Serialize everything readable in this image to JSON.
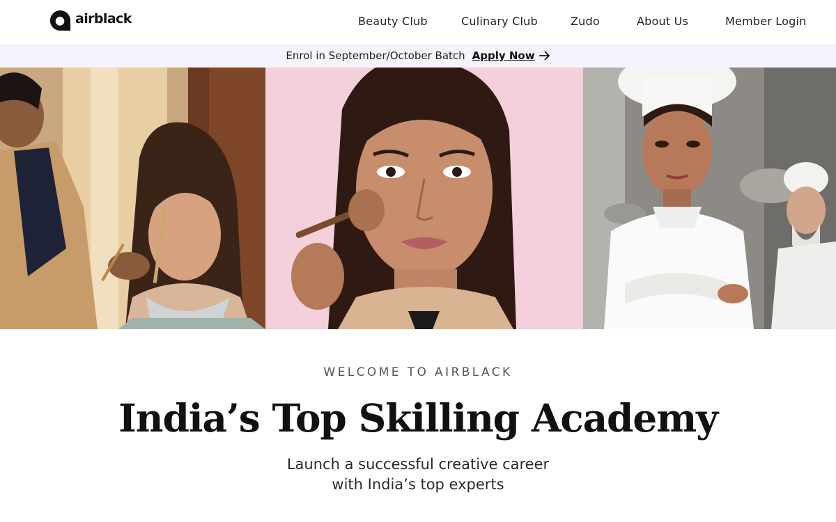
{
  "brand": {
    "name": "airblack",
    "logo_icon": "airblack-logo-icon"
  },
  "nav": {
    "links": [
      {
        "label": "Beauty Club"
      },
      {
        "label": "Culinary Club"
      },
      {
        "label": "Zudo"
      },
      {
        "label": "About Us"
      },
      {
        "label": "Member Login"
      }
    ]
  },
  "announcement": {
    "text": "Enrol in September/October Batch",
    "cta_label": "Apply Now",
    "cta_icon": "arrow-right-icon"
  },
  "hero": {
    "images": [
      {
        "alt": "Makeup artist applying makeup to a bride"
      },
      {
        "alt": "Woman applying blush with a brush"
      },
      {
        "alt": "Chef in white chef uniform"
      }
    ]
  },
  "intro": {
    "eyebrow": "WELCOME TO AIRBLACK",
    "headline": "India’s Top Skilling Academy",
    "subline_1": "Launch a successful creative career",
    "subline_2": "with India’s top experts"
  },
  "colors": {
    "announcement_bg": "#f5f4fd",
    "text_dark": "#111111",
    "accent_pink": "#f2c8d6"
  }
}
